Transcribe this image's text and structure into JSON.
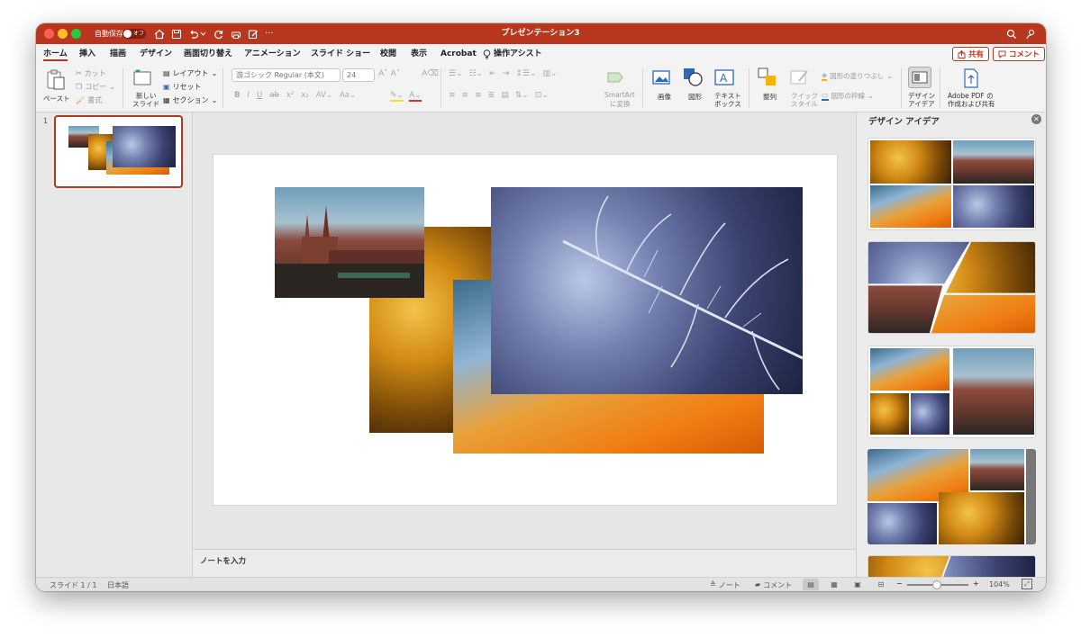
{
  "window": {
    "title": "プレゼンテーション3"
  },
  "titlebar": {
    "autosave_label": "自動保存",
    "autosave_state": "オフ",
    "more": "···"
  },
  "tabs": [
    "ホーム",
    "挿入",
    "描画",
    "デザイン",
    "画面切り替え",
    "アニメーション",
    "スライド ショー",
    "校閲",
    "表示",
    "Acrobat",
    "操作アシスト"
  ],
  "share_button": "共有",
  "comment_button": "コメント",
  "ribbon": {
    "paste": "ペースト",
    "cut": "カット",
    "copy": "コピー",
    "format": "書式",
    "new_slide_1": "新しい",
    "new_slide_2": "スライド",
    "layout": "レイアウト",
    "reset": "リセット",
    "section": "セクション",
    "font_name": "游ゴシック Regular (本文)",
    "font_size": "24",
    "smartart_1": "SmartArt",
    "smartart_2": "に変換",
    "image": "画像",
    "shapes": "図形",
    "textbox_1": "テキスト",
    "textbox_2": "ボックス",
    "arrange": "整列",
    "quick_style_1": "クイック",
    "quick_style_2": "スタイル",
    "shape_fill": "図形の塗りつぶし",
    "shape_outline": "図形の枠線",
    "designer_1": "デザイン",
    "designer_2": "アイデア",
    "adobe_1": "Adobe PDF の",
    "adobe_2": "作成および共有"
  },
  "thumbnail": {
    "number": "1"
  },
  "notes": {
    "placeholder": "ノートを入力"
  },
  "design_pane": {
    "title": "デザイン アイデア"
  },
  "status": {
    "slide_info": "スライド 1 / 1",
    "language": "日本語",
    "notes": "ノート",
    "comments": "コメント",
    "zoom": "104%",
    "zoom_minus": "−",
    "zoom_plus": "+"
  },
  "colors": {
    "accent": "#b7371f"
  }
}
